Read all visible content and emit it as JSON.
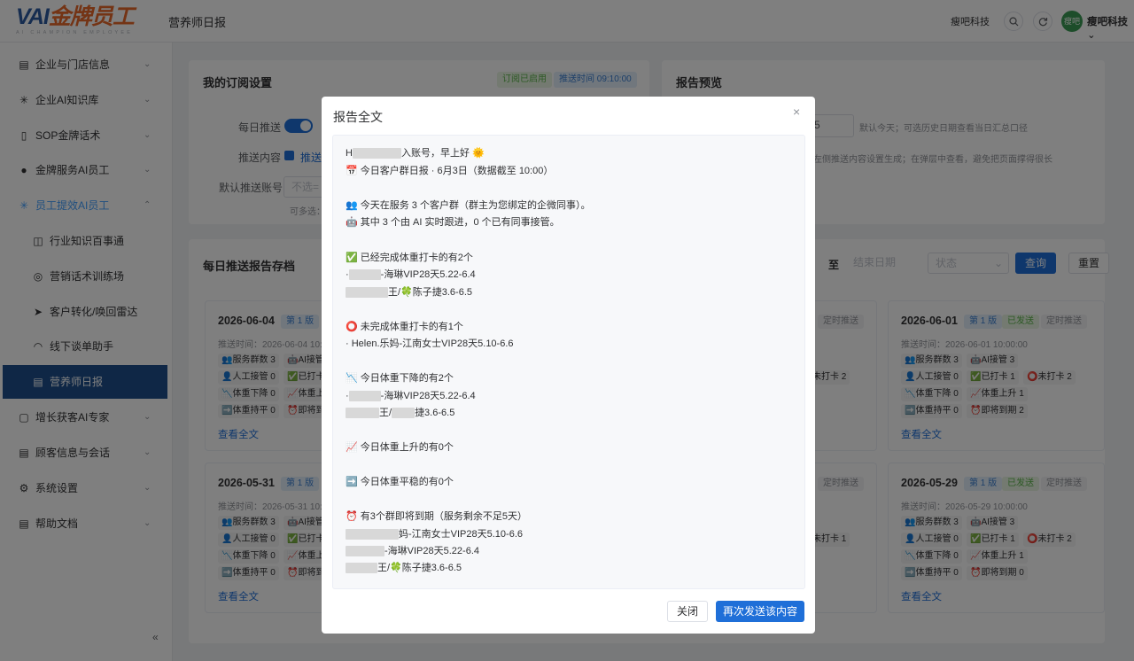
{
  "header": {
    "logo_main_a": "VAI",
    "logo_main_b": "金牌员工",
    "logo_sub": "AI CHAMPION EMPLOYEE",
    "title": "营养师日报",
    "company": "瘦吧科技",
    "avatar_text": "瘦吧",
    "username": "瘦吧科技",
    "username_arrow": "⌄"
  },
  "sidebar": {
    "items": [
      {
        "label": "企业与门店信息",
        "icon": "building-icon",
        "glyph": "▤",
        "arrow": "⌄"
      },
      {
        "label": "企业AI知识库",
        "icon": "sparkle-icon",
        "glyph": "✳",
        "arrow": "⌄"
      },
      {
        "label": "SOP金牌话术",
        "icon": "phone-icon",
        "glyph": "▯",
        "arrow": "⌄"
      },
      {
        "label": "金牌服务AI员工",
        "icon": "user-icon",
        "glyph": "●",
        "arrow": "⌄"
      },
      {
        "label": "员工提效AI员工",
        "icon": "sparkle-icon",
        "glyph": "✳",
        "arrow": "⌃"
      },
      {
        "label": "行业知识百事通",
        "icon": "car-icon",
        "glyph": "◫"
      },
      {
        "label": "营销话术训练场",
        "icon": "target-icon",
        "glyph": "◎"
      },
      {
        "label": "客户转化/唤回雷达",
        "icon": "send-icon",
        "glyph": "➤"
      },
      {
        "label": "线下谈单助手",
        "icon": "headset-icon",
        "glyph": "◠"
      },
      {
        "label": "营养师日报",
        "icon": "document-icon",
        "glyph": "▤"
      },
      {
        "label": "增长获客AI专家",
        "icon": "cup-icon",
        "glyph": "▢",
        "arrow": "⌄"
      },
      {
        "label": "顾客信息与会话",
        "icon": "document-icon",
        "glyph": "▤",
        "arrow": "⌄"
      },
      {
        "label": "系统设置",
        "icon": "gear-icon",
        "glyph": "⚙",
        "arrow": "⌄"
      },
      {
        "label": "帮助文档",
        "icon": "document-icon",
        "glyph": "▤",
        "arrow": "⌄"
      }
    ],
    "collapse_glyph": "«"
  },
  "subscription": {
    "title": "我的订阅设置",
    "status_tag": "订阅已启用",
    "time_tag": "推送时间 09:10:00",
    "daily_push_label": "每日推送",
    "content_label": "推送内容",
    "content_value": "推送",
    "account_label": "默认推送账号",
    "account_placeholder": "不选=",
    "hint": "可多选："
  },
  "preview": {
    "title": "报告预览",
    "date_value": "5",
    "hint1": "默认今天；可选历史日期查看当日汇总口径",
    "hint2": "左侧推送内容设置生成；在弹层中查看，避免把页面撑得很长"
  },
  "archive": {
    "title": "每日推送报告存档",
    "to_label": "至",
    "end_date_placeholder": "结束日期",
    "status_placeholder": "状态",
    "query_button": "查询",
    "reset_button": "重置",
    "view_full": "查看全文"
  },
  "cards": {
    "c1": {
      "date": "2026-06-04",
      "version": "第 1 版",
      "time": "推送时间：2026-06-04 10:",
      "s1": "👥服务群数 3",
      "s2": "🤖AI接管",
      "s3": "👤人工接管 0",
      "s4": "✅已打卡",
      "s5": "📉体重下降 0",
      "s6": "📈体重上",
      "s7": "➡️体重持平 0",
      "s8": "⏰即将到"
    },
    "c2": {
      "date": "2026-05-31",
      "version": "第 1 版",
      "time": "推送时间：2026-05-31 10:0",
      "s1": "👥服务群数 3",
      "s2": "🤖AI接管",
      "s3": "👤人工接管 0",
      "s4": "✅已打卡",
      "s5": "📉体重下降 0",
      "s6": "📈体重上",
      "s7": "➡️体重持平 0",
      "s8": "⏰即将到"
    },
    "c3": {
      "tag": "定时推送",
      "s1": "未打卡 2"
    },
    "c4": {
      "tag": "定时推送",
      "s1": "未打卡 1"
    },
    "c5": {
      "date": "2026-06-01",
      "version": "第 1 版",
      "sent": "已发送",
      "sched": "定时推送",
      "time": "推送时间：2026-06-01 10:00:00",
      "s1": "👥服务群数 3",
      "s2": "🤖AI接管 3",
      "s3": "👤人工接管 0",
      "s4": "✅已打卡 1",
      "s5": "⭕未打卡 2",
      "s6": "📉体重下降 0",
      "s7": "📈体重上升 1",
      "s8": "➡️体重持平 0",
      "s9": "⏰即将到期 2"
    },
    "c6": {
      "date": "2026-05-29",
      "version": "第 1 版",
      "sent": "已发送",
      "sched": "定时推送",
      "time": "推送时间：2026-05-29 10:00:00",
      "s1": "👥服务群数 3",
      "s2": "🤖AI接管 3",
      "s3": "👤人工接管 0",
      "s4": "✅已打卡 1",
      "s5": "⭕未打卡 2",
      "s6": "📉体重下降 0",
      "s7": "📈体重上升 1",
      "s8": "➡️体重持平 0",
      "s9": "⏰即将到期 0"
    }
  },
  "modal": {
    "title": "报告全文",
    "close_glyph": "×",
    "lines": {
      "l1a": "H",
      "l1b": "入账号，早上好 🌞",
      "l2": "📅 今日客户群日报 · 6月3日（数据截至 10:00）",
      "l3": "👥 今天在服务 3 个客户群（群主为您绑定的企微同事）。",
      "l4": "🤖 其中 3 个由 AI 实时跟进，0 个已有同事接管。",
      "l5": "✅ 已经完成体重打卡的有2个",
      "l6a": "·",
      "l6b": "-海琳VIP28天5.22-6.4",
      "l7b": "王/🍀陈子捷3.6-6.5",
      "l8": "⭕ 未完成体重打卡的有1个",
      "l9": "· Helen.乐妈-江南女士VIP28天5.10-6.6",
      "l10": "📉 今日体重下降的有2个",
      "l11a": "·",
      "l11b": "-海琳VIP28天5.22-6.4",
      "l12b": "王/",
      "l12c": "捷3.6-6.5",
      "l13": "📈 今日体重上升的有0个",
      "l14": "➡️ 今日体重平稳的有0个",
      "l15": "⏰ 有3个群即将到期（服务剩余不足5天）",
      "l16b": "妈-江南女士VIP28天5.10-6.6",
      "l17b": "-海琳VIP28天5.22-6.4",
      "l18b": "王/🍀陈子捷3.6-6.5"
    },
    "close_button": "关闭",
    "resend_button": "再次发送该内容"
  }
}
